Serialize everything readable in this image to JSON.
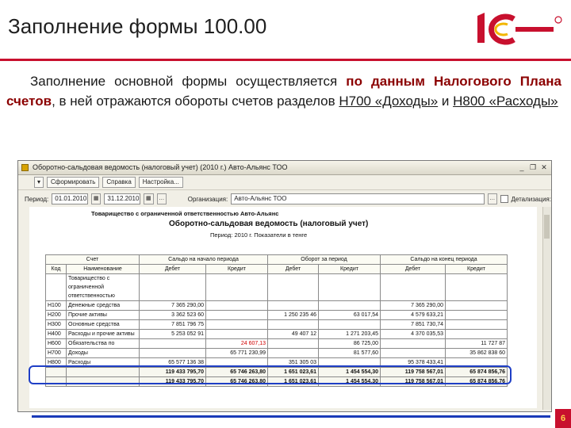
{
  "slide": {
    "title": "Заполнение формы 100.00",
    "page_number": "6",
    "accent_color": "#c8102e",
    "logo_alt": "1С"
  },
  "intro": {
    "part1": "Заполнение основной формы осуществляется ",
    "emph": "по данным Налогового Плана счетов",
    "part2": ", в ней отражаются обороты счетов разделов ",
    "link1": "Н700 «Доходы»",
    "part3": " и ",
    "link2": "Н800 «Расходы»"
  },
  "window": {
    "title": "Оборотно-сальдовая ведомость (налоговый учет) (2010 г.) Авто-Альянс ТОО",
    "toolbar": {
      "generate_label": "Сформировать",
      "help_label": "Справка",
      "settings_label": "Настройка..."
    },
    "filters": {
      "period_label": "Период:",
      "date_from": "01.01.2010",
      "date_to": "31.12.2010",
      "org_label": "Организация:",
      "org_value": "Авто-Альянс ТОО",
      "details_label": "Детализация:"
    },
    "report": {
      "org_name": "Товарищество с ограниченной ответственностью Авто-Альянс",
      "title": "Оборотно-сальдовая ведомость (налоговый учет)",
      "period": "Период: 2010 г. Показатели в тенге",
      "col_groups": [
        "Счет",
        "Сальдо на начало периода",
        "Оборот за период",
        "Сальдо на конец периода"
      ],
      "col_subs": [
        "Код",
        "Наименование",
        "Дебет",
        "Кредит",
        "Дебет",
        "Кредит",
        "Дебет",
        "Кредит"
      ],
      "rows": [
        [
          "",
          "Товарищество с ограниченной ответственностью",
          "",
          "",
          "",
          "",
          "",
          ""
        ],
        [
          "Н100",
          "Денежные средства",
          "7 365 290,00",
          "",
          "",
          "",
          "7 365 290,00",
          ""
        ],
        [
          "Н200",
          "Прочие активы",
          "3 362 523 60",
          "",
          "1 250 235 46",
          "63 017,54",
          "4 579 633,21",
          ""
        ],
        [
          "Н300",
          "Основные средства",
          "7 851 796 75",
          "",
          "",
          "",
          "7 851 730,74",
          ""
        ],
        [
          "Н400",
          "Расходы и прочие активы",
          "5 253 052 91",
          "",
          "49 407 12",
          "1 271 203,45",
          "4 370 035,53",
          ""
        ],
        [
          "Н600",
          "Обязательства по",
          "",
          "24 607,13",
          "",
          "86 725,00",
          "",
          "11 727 87"
        ],
        [
          "Н700",
          "Доходы",
          "",
          "65 771 230,99",
          "",
          "81 577,60",
          "",
          "35 862 838 60"
        ],
        [
          "Н800",
          "Расходы",
          "65 577 136 38",
          "",
          "351 305 03",
          "",
          "95 378 433,41",
          ""
        ]
      ],
      "totals": [
        [
          "",
          "",
          "119 433 795,70",
          "65 746 263,80",
          "1 651 023,61",
          "1 454 554,30",
          "119 758 567,01",
          "65 874 856,76"
        ],
        [
          "",
          "",
          "119 433 795,70",
          "65 746 263,80",
          "1 651 023,61",
          "1 454 554,30",
          "119 758 567,01",
          "65 874 856,76"
        ]
      ]
    }
  }
}
